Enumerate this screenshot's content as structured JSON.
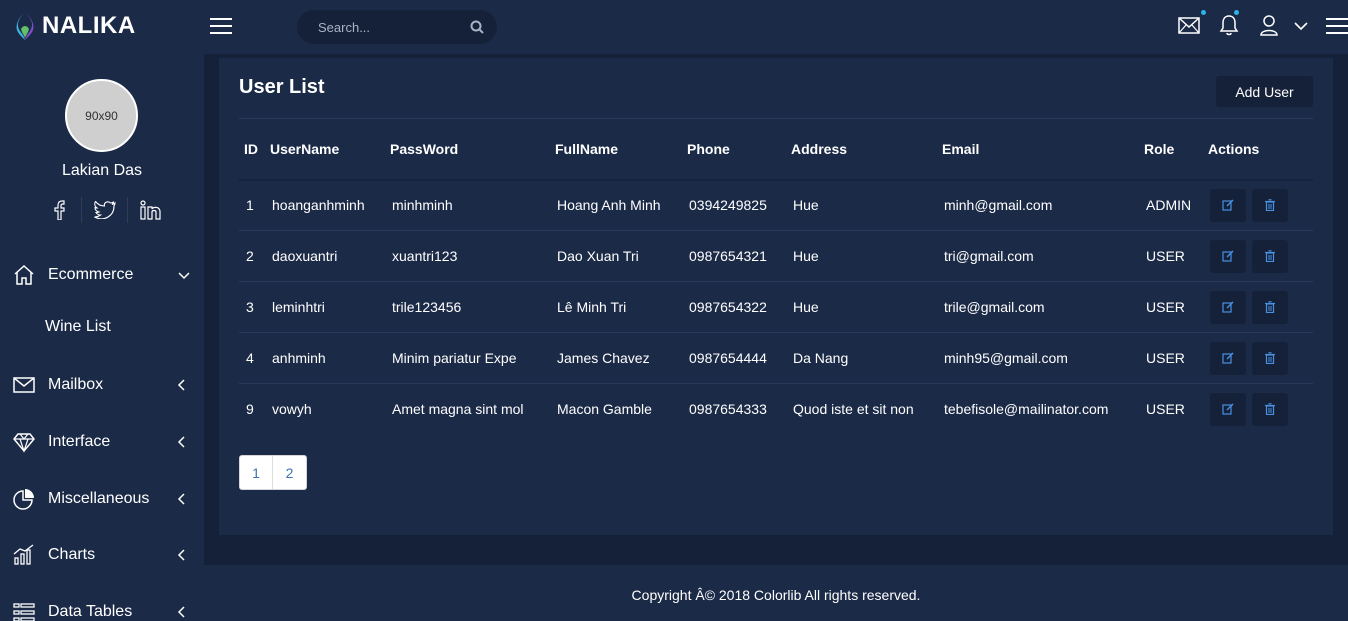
{
  "brand": {
    "name": "NALIKA"
  },
  "search": {
    "placeholder": "Search..."
  },
  "header": {
    "icons": [
      "mail-icon",
      "bell-icon",
      "user-icon",
      "chevron-down-icon",
      "menu-icon"
    ],
    "accent": "#2ab4e8"
  },
  "profile": {
    "avatar_text": "90x90",
    "name": "Lakian Das",
    "socials": [
      "facebook-icon",
      "twitter-icon",
      "linkedin-icon"
    ]
  },
  "sidebar": {
    "items": [
      {
        "label": "Ecommerce",
        "icon": "home-icon"
      },
      {
        "label": "Wine List"
      },
      {
        "label": "Mailbox",
        "icon": "envelope-icon"
      },
      {
        "label": "Interface",
        "icon": "diamond-icon"
      },
      {
        "label": "Miscellaneous",
        "icon": "pie-chart-icon"
      },
      {
        "label": "Charts",
        "icon": "bar-chart-icon"
      },
      {
        "label": "Data Tables",
        "icon": "table-icon"
      }
    ]
  },
  "main": {
    "title": "User List",
    "add_button": "Add User",
    "columns": [
      "ID",
      "UserName",
      "PassWord",
      "FullName",
      "Phone",
      "Address",
      "Email",
      "Role",
      "Actions"
    ],
    "rows": [
      [
        "1",
        "hoanganhminh",
        "minhminh",
        "Hoang Anh Minh",
        "0394249825",
        "Hue",
        "minh@gmail.com",
        "ADMIN"
      ],
      [
        "2",
        "daoxuantri",
        "xuantri123",
        "Dao Xuan Tri",
        "0987654321",
        "Hue",
        "tri@gmail.com",
        "USER"
      ],
      [
        "3",
        "leminhtri",
        "trile123456",
        "Lê Minh Tri",
        "0987654322",
        "Hue",
        "trile@gmail.com",
        "USER"
      ],
      [
        "4",
        "anhminh",
        "Minim pariatur Expe",
        "James Chavez",
        "0987654444",
        "Da Nang",
        "minh95@gmail.com",
        "USER"
      ],
      [
        "9",
        "vowyh",
        "Amet magna sint mol",
        "Macon Gamble",
        "0987654333",
        "Quod iste et sit non",
        "tebefisole@mailinator.com",
        "USER"
      ]
    ],
    "pagination": [
      "1",
      "2"
    ]
  },
  "footer": {
    "text": "Copyright Â© 2018 Colorlib All rights reserved."
  }
}
